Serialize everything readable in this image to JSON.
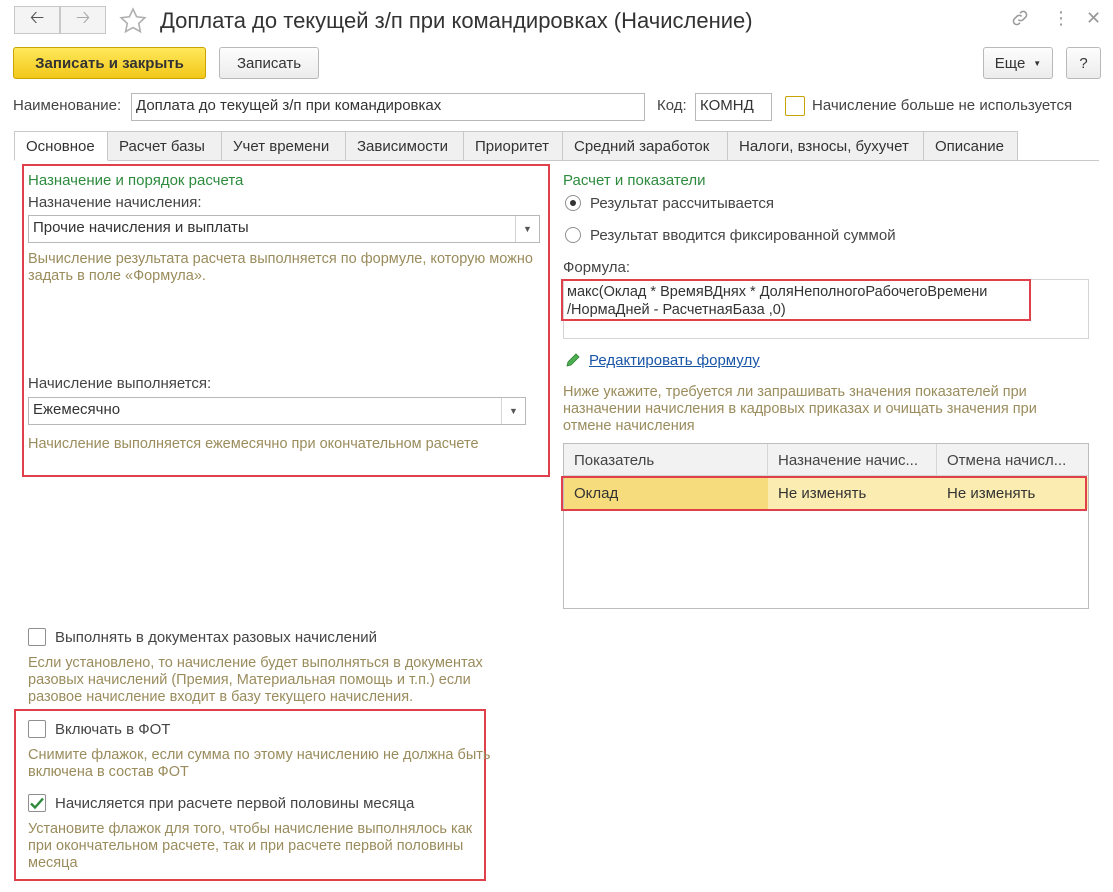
{
  "window": {
    "title": "Доплата до текущей з/п при командировках (Начисление)"
  },
  "toolbar": {
    "save_close_label": "Записать и закрыть",
    "save_label": "Записать",
    "more_label": "Еще",
    "help_label": "?"
  },
  "header": {
    "name_label": "Наименование:",
    "name_value": "Доплата до текущей з/п при командировках",
    "code_label": "Код:",
    "code_value": "КОМНД",
    "not_used_label": "Начисление больше не используется"
  },
  "tabs": [
    {
      "label": "Основное"
    },
    {
      "label": "Расчет базы"
    },
    {
      "label": "Учет времени"
    },
    {
      "label": "Зависимости"
    },
    {
      "label": "Приоритет"
    },
    {
      "label": "Средний заработок"
    },
    {
      "label": "Налоги, взносы, бухучет"
    },
    {
      "label": "Описание"
    }
  ],
  "left": {
    "section_title": "Назначение и порядок расчета",
    "purpose_label": "Назначение начисления:",
    "purpose_value": "Прочие начисления и выплаты",
    "purpose_hint": "Вычисление результата расчета выполняется по формуле, которую можно задать в поле «Формула».",
    "schedule_label": "Начисление выполняется:",
    "schedule_value": "Ежемесячно",
    "schedule_hint": "Начисление выполняется ежемесячно при окончательном расчете",
    "one_time_label": "Выполнять в документах разовых начислений",
    "one_time_hint": "Если установлено, то начисление будет выполняться в документах разовых начислений (Премия, Материальная помощь и т.п.) если разовое начисление входит в базу текущего начисления.",
    "fot_label": "Включать в ФОТ",
    "fot_hint": "Снимите флажок, если сумма по этому начислению не должна быть включена в состав ФОТ",
    "half_month_label": "Начисляется при расчете первой половины месяца",
    "half_month_hint": "Установите флажок для того, чтобы начисление выполнялось как при окончательном расчете, так и при расчете первой половины месяца"
  },
  "right": {
    "section_title": "Расчет и показатели",
    "radio_calculated": "Результат рассчитывается",
    "radio_fixed": "Результат вводится фиксированной суммой",
    "formula_label": "Формула:",
    "formula_line1": "макс(Оклад * ВремяВДнях * ДоляНеполногоРабочегоВремени",
    "formula_line2": "/НормаДней  - РасчетнаяБаза ,0)",
    "edit_formula_link": "Редактировать формулу",
    "indicators_hint": "Ниже укажите, требуется ли запрашивать значения показателей при назначении начисления в кадровых приказах и очищать значения при отмене начисления",
    "table": {
      "columns": [
        "Показатель",
        "Назначение начис...",
        "Отмена начисл..."
      ],
      "rows": [
        [
          "Оклад",
          "Не изменять",
          "Не изменять"
        ]
      ]
    }
  },
  "colors": {
    "accent_yellow": "#f2c81a",
    "section_green": "#2e8b3e",
    "hint_text": "#9a8c5c",
    "highlight_red": "#e0404a",
    "selected_row": "#fbedb2",
    "link_blue": "#1a56a8"
  },
  "state": {
    "not_used_checked": false,
    "one_time_checked": false,
    "fot_checked": false,
    "half_month_checked": true,
    "result_mode": "calculated"
  }
}
